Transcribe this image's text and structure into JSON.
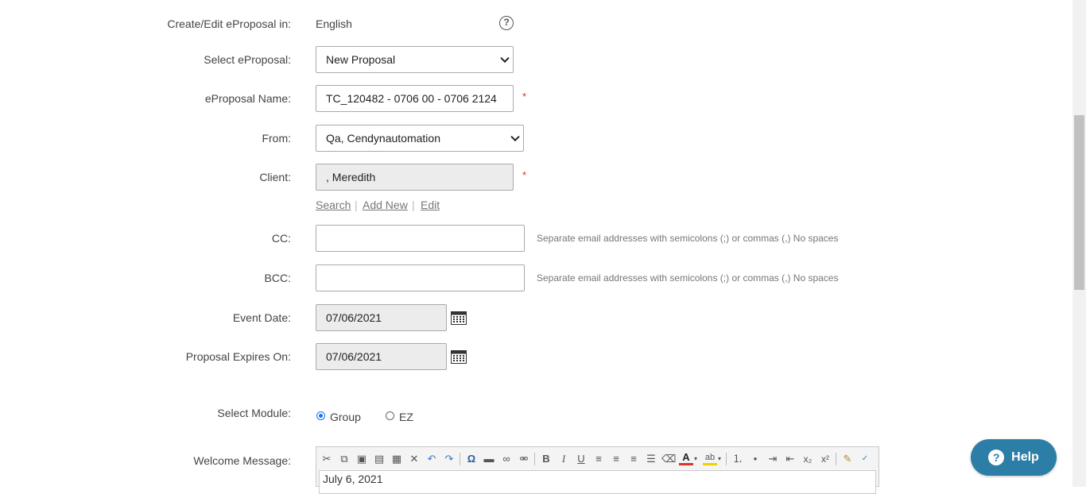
{
  "form": {
    "language": {
      "label": "Create/Edit eProposal in:",
      "value": "English"
    },
    "select_eproposal": {
      "label": "Select eProposal:",
      "value": "New Proposal"
    },
    "eproposal_name": {
      "label": "eProposal Name:",
      "value": "TC_120482 - 0706 00 - 0706 2124",
      "required": "*"
    },
    "from": {
      "label": "From:",
      "value": "Qa, Cendynautomation"
    },
    "client": {
      "label": "Client:",
      "value": ", Meredith",
      "required": "*"
    },
    "client_links": {
      "search": "Search",
      "add_new": "Add New",
      "edit": "Edit",
      "sep": "|"
    },
    "cc": {
      "label": "CC:",
      "value": "",
      "hint": "Separate email addresses with semicolons (;) or commas (,) No spaces"
    },
    "bcc": {
      "label": "BCC:",
      "value": "",
      "hint": "Separate email addresses with semicolons (;) or commas (,) No spaces"
    },
    "event_date": {
      "label": "Event Date:",
      "value": "07/06/2021"
    },
    "expires_on": {
      "label": "Proposal Expires On:",
      "value": "07/06/2021"
    },
    "module": {
      "label": "Select Module:",
      "options": [
        "Group",
        "EZ"
      ],
      "selected": "Group"
    },
    "welcome": {
      "label": "Welcome Message:",
      "content": "July 6, 2021"
    }
  },
  "help_button": {
    "label": "Help",
    "icon": "?"
  },
  "info_icon": "?",
  "colors": {
    "required": "#d9342b",
    "accent": "#2c7ea6",
    "radio": "#1a73e8"
  }
}
